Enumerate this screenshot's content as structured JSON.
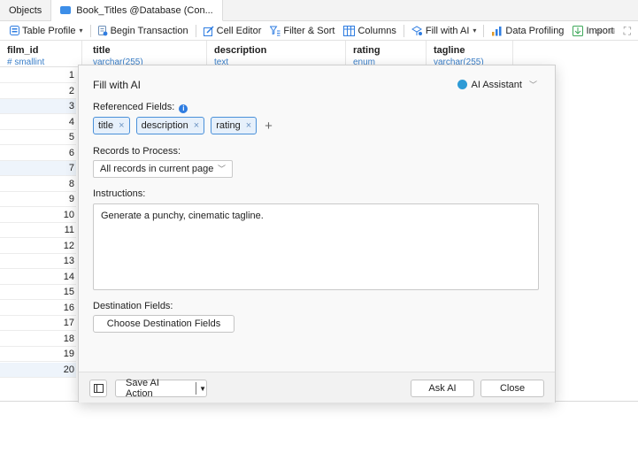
{
  "tabs": [
    {
      "label": "Objects",
      "active": false
    },
    {
      "label": "Book_Titles @Database (Con...",
      "active": true
    }
  ],
  "toolbar": {
    "table_profile": "Table Profile",
    "begin_transaction": "Begin Transaction",
    "cell_editor": "Cell Editor",
    "filter_sort": "Filter & Sort",
    "columns": "Columns",
    "fill_with_ai": "Fill with AI",
    "data_profiling": "Data Profiling",
    "import": "Import",
    "more": "»"
  },
  "grid": {
    "columns": [
      {
        "name": "film_id",
        "type": "# smallint"
      },
      {
        "name": "title",
        "type": "varchar(255)"
      },
      {
        "name": "description",
        "type": "text"
      },
      {
        "name": "rating",
        "type": "enum"
      },
      {
        "name": "tagline",
        "type": "varchar(255)"
      }
    ],
    "row_values": [
      "1",
      "2",
      "3",
      "4",
      "5",
      "6",
      "7",
      "8",
      "9",
      "10",
      "11",
      "12",
      "13",
      "14",
      "15",
      "16",
      "17",
      "18",
      "19",
      "20"
    ]
  },
  "dialog": {
    "title": "Fill with AI",
    "assistant_label": "AI Assistant",
    "referenced_fields_label": "Referenced Fields:",
    "referenced_fields": [
      "title",
      "description",
      "rating"
    ],
    "records_label": "Records to Process:",
    "records_value": "All records in current page",
    "instructions_label": "Instructions:",
    "instructions_value": "Generate a punchy, cinematic tagline.",
    "destination_label": "Destination Fields:",
    "choose_destination": "Choose Destination Fields",
    "save_action": "Save AI Action",
    "ask_ai": "Ask AI",
    "close": "Close"
  },
  "colors": {
    "accent": "#2f7de1",
    "chip_border": "#4a90d9",
    "chip_fill": "#e6f0fb",
    "type_blue": "#3a7fc9"
  }
}
